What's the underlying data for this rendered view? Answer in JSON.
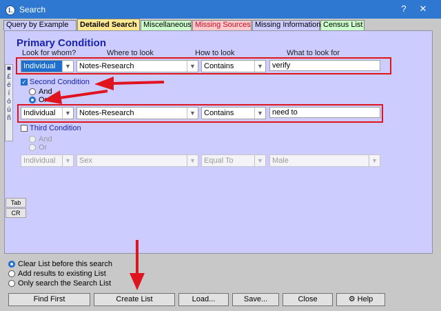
{
  "window": {
    "title": "Search",
    "app_icon": "L"
  },
  "tabs": [
    {
      "label": "Query by Example",
      "bg": "#ccccff",
      "color": "#000000"
    },
    {
      "label": "Detailed Search",
      "bg": "#ffe890",
      "color": "#000000",
      "active": true
    },
    {
      "label": "Miscellaneous",
      "bg": "#ccffcc",
      "color": "#000000"
    },
    {
      "label": "Missing Sources",
      "bg": "#ffc8cc",
      "color": "#c01020"
    },
    {
      "label": "Missing Information",
      "bg": "#ccccff",
      "color": "#000000"
    },
    {
      "label": "Census List",
      "bg": "#ccffcc",
      "color": "#000000"
    }
  ],
  "primary": {
    "heading": "Primary Condition",
    "col_who": "Look for whom?",
    "col_where": "Where to look",
    "col_how": "How to look",
    "col_what": "What to look for",
    "who": "Individual",
    "where": "Notes-Research",
    "how": "Contains",
    "what": "verify"
  },
  "second": {
    "label": "Second Condition",
    "checked": true,
    "and_label": "And",
    "or_label": "Or",
    "who": "Individual",
    "where": "Notes-Research",
    "how": "Contains",
    "what": "need to"
  },
  "third": {
    "label": "Third Condition",
    "checked": false,
    "and_label": "And",
    "or_label": "Or",
    "who": "Individual",
    "where": "Sex",
    "how": "Equal To",
    "what": "Male"
  },
  "char_strip": [
    "■",
    "£",
    "é",
    "í",
    "ó",
    "ú",
    "ñ"
  ],
  "side_buttons": {
    "tab": "Tab",
    "cr": "CR"
  },
  "options": {
    "clear_list": "Clear List before this search",
    "add_results": "Add results to existing List",
    "only_search": "Only search the Search List"
  },
  "buttons": {
    "find_first": "Find First",
    "create_list": "Create List",
    "load": "Load...",
    "save": "Save...",
    "close": "Close",
    "help": "Help"
  },
  "colors": {
    "title_bar": "#2f78d2",
    "panel": "#ccccff",
    "annotation_red": "#e0141e",
    "heading": "#1a22b0"
  }
}
